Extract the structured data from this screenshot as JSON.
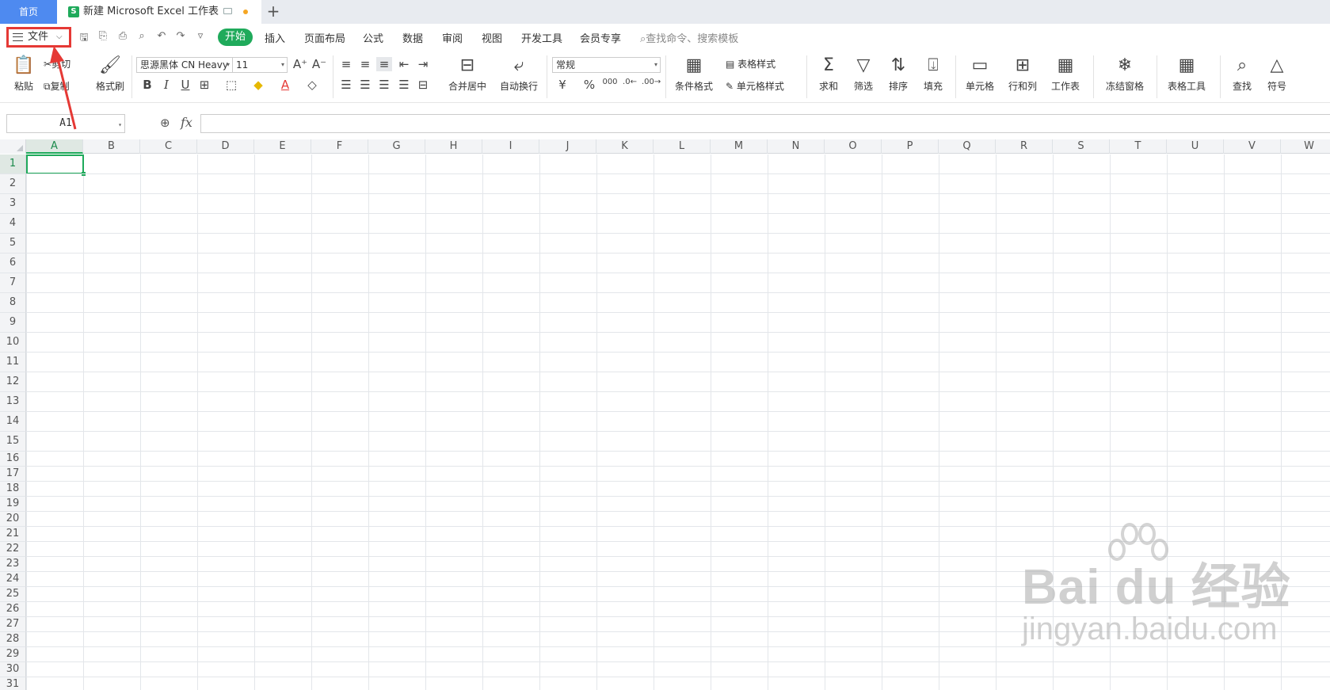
{
  "titlebar": {
    "home_tab": "首页",
    "doc_tab": "新建 Microsoft Excel 工作表",
    "doc_icon_letter": "S",
    "add_tab": "+"
  },
  "menubar": {
    "file_label": "文件",
    "active_tab": "开始",
    "tabs": [
      "插入",
      "页面布局",
      "公式",
      "数据",
      "审阅",
      "视图",
      "开发工具",
      "会员专享"
    ],
    "search_placeholder": "查找命令、搜索模板"
  },
  "ribbon": {
    "paste": "粘贴",
    "cut": "剪切",
    "copy": "复制",
    "format_painter": "格式刷",
    "font_name": "思源黑体 CN Heavy",
    "font_size": "11",
    "merge_center": "合并居中",
    "wrap_text": "自动换行",
    "number_format": "常规",
    "conditional_format": "条件格式",
    "table_style": "表格样式",
    "cell_style": "单元格样式",
    "sum": "求和",
    "filter": "筛选",
    "sort": "排序",
    "fill": "填充",
    "cell": "单元格",
    "row_col": "行和列",
    "worksheet": "工作表",
    "freeze": "冻结窗格",
    "table_tools": "表格工具",
    "find": "查找",
    "symbol": "符号"
  },
  "formula_bar": {
    "name_box": "A1",
    "fx_label": "fx",
    "formula": ""
  },
  "sheet": {
    "columns": [
      "A",
      "B",
      "C",
      "D",
      "E",
      "F",
      "G",
      "H",
      "I",
      "J",
      "K",
      "L",
      "M",
      "N",
      "O",
      "P",
      "Q",
      "R",
      "S",
      "T",
      "U",
      "V",
      "W"
    ],
    "rows": [
      "1",
      "2",
      "3",
      "4",
      "5",
      "6",
      "7",
      "8",
      "9",
      "10",
      "11",
      "12",
      "13",
      "14",
      "15",
      "16",
      "17",
      "18",
      "19",
      "20",
      "21",
      "22",
      "23",
      "24",
      "25",
      "26",
      "27",
      "28",
      "29",
      "30",
      "31"
    ],
    "selected_cell": "A1"
  },
  "watermark": {
    "main": "Bai du 经验",
    "sub": "jingyan.baidu.com"
  },
  "colors": {
    "accent_green": "#1faa5b",
    "home_tab_blue": "#4e8af0",
    "annotation_red": "#e53935"
  }
}
